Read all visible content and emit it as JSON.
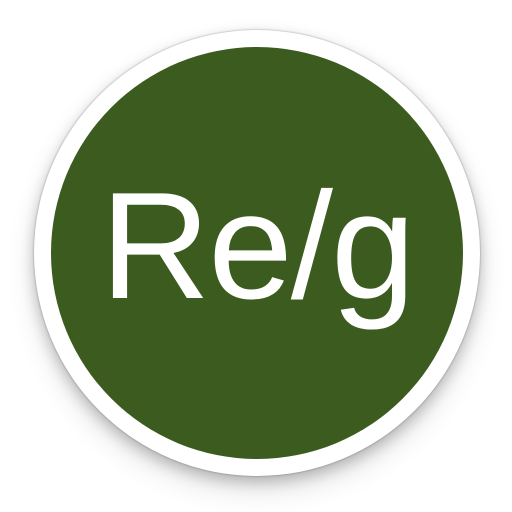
{
  "icon": {
    "label": "Re/g",
    "colors": {
      "disc": "#3b5b1f",
      "ring": "#ffffff",
      "text": "#ffffff"
    }
  }
}
